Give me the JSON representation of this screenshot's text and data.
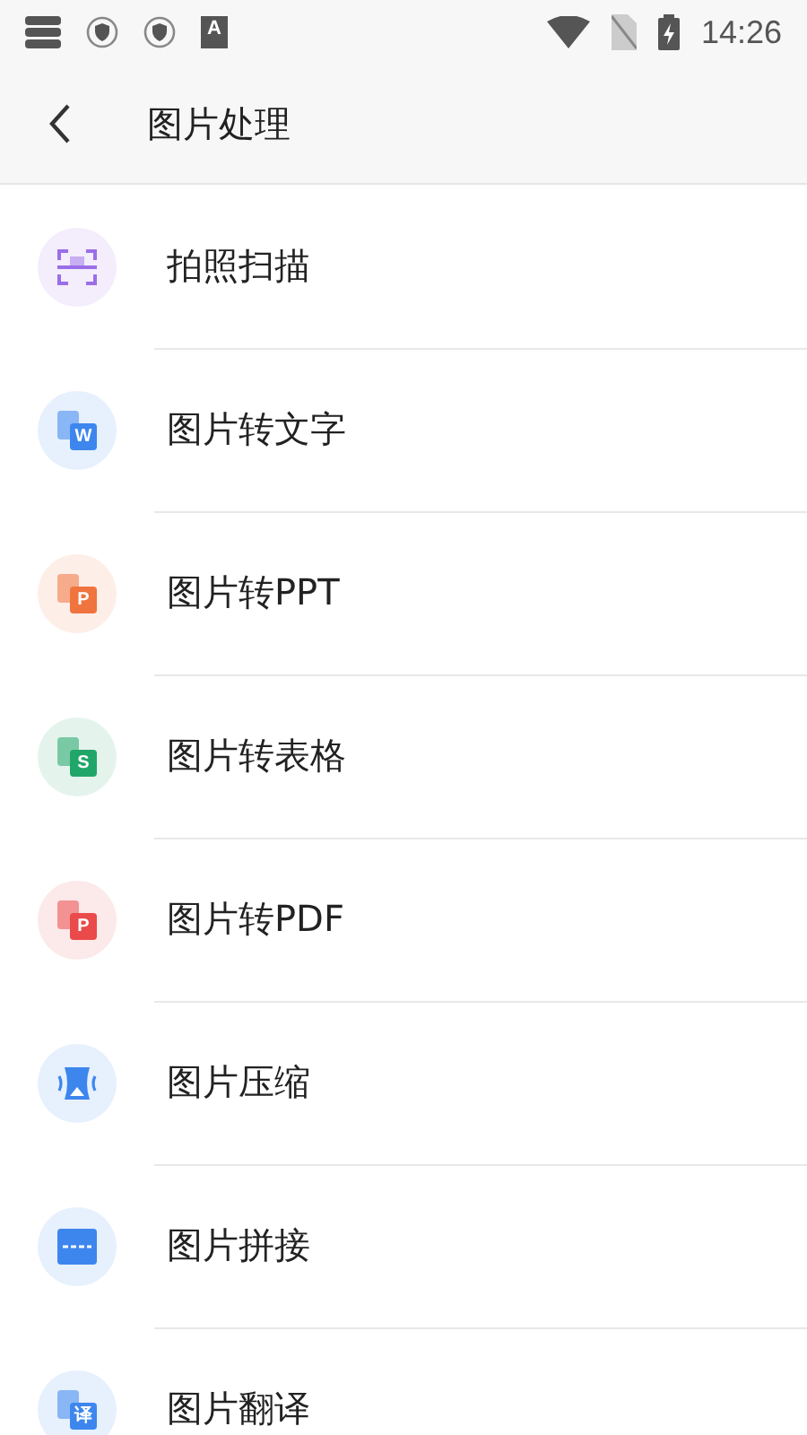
{
  "status_bar": {
    "left_glyph": "A",
    "time": "14:26"
  },
  "header": {
    "title": "图片处理"
  },
  "items": [
    {
      "label": "拍照扫描",
      "kind": "scan",
      "color": "#9b6ee8"
    },
    {
      "label": "图片转文字",
      "kind": "doc",
      "color": "#3d86ee",
      "glyph": "W"
    },
    {
      "label": "图片转PPT",
      "kind": "doc",
      "color": "#f0743e",
      "glyph": "P"
    },
    {
      "label": "图片转表格",
      "kind": "doc",
      "color": "#21a66a",
      "glyph": "S"
    },
    {
      "label": "图片转PDF",
      "kind": "doc",
      "color": "#ea4a4a",
      "glyph": "P"
    },
    {
      "label": "图片压缩",
      "kind": "compress",
      "color": "#3d86ee"
    },
    {
      "label": "图片拼接",
      "kind": "stitch",
      "color": "#3d86ee"
    },
    {
      "label": "图片翻译",
      "kind": "doc",
      "color": "#3d86ee",
      "glyph": "译"
    }
  ]
}
